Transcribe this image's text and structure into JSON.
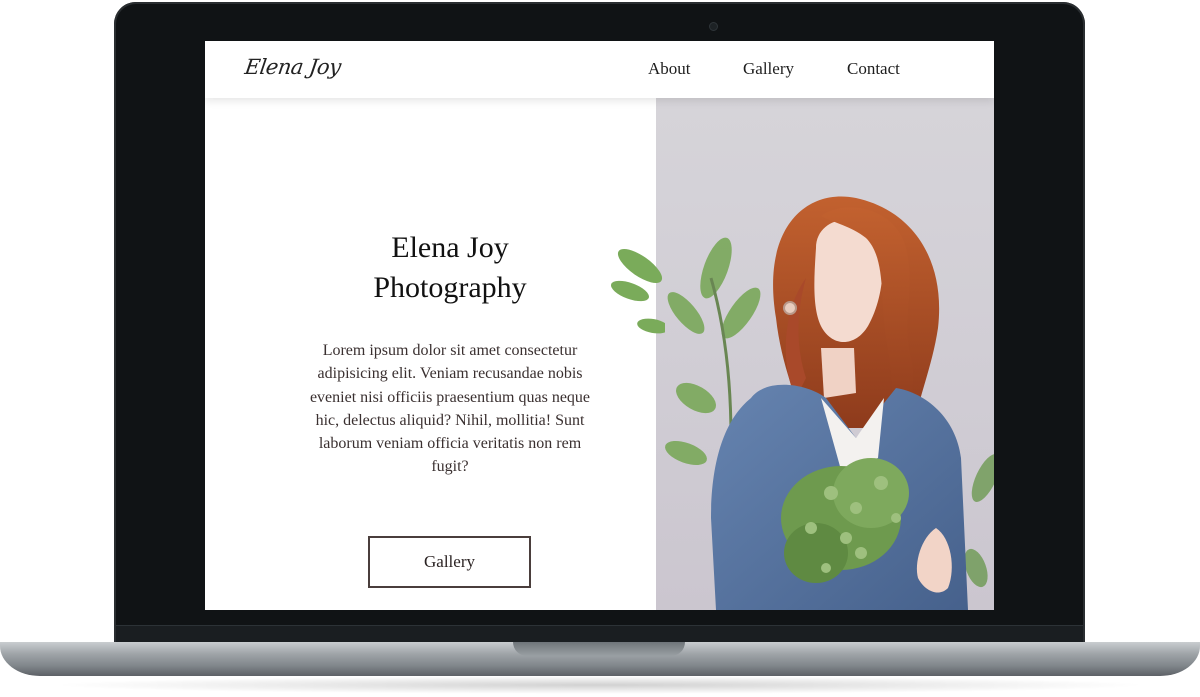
{
  "site": {
    "logo": "Elena Joy",
    "nav": {
      "about": "About",
      "gallery": "Gallery",
      "contact": "Contact"
    }
  },
  "hero": {
    "title_line1": "Elena Joy",
    "title_line2": "Photography",
    "text": "Lorem ipsum dolor sit amet consectetur adipisicing elit. Veniam recusandae nobis eveniet nisi officiis praesentium quas neque hic, delectus aliquid? Nihil, mollitia! Sunt laborum veniam officia veritatis non rem fugit?",
    "button_label": "Gallery"
  },
  "colors": {
    "laptop_bezel": "#101315",
    "screen_bg": "#ffffff",
    "text_dark": "#111111",
    "button_border": "#4a3e3c",
    "photo_bg": "#d4d1d8",
    "hair": "#b8552a",
    "sweater": "#5676a3",
    "foliage": "#6e9a4e"
  },
  "icons": {
    "camera": "webcam-dot"
  }
}
